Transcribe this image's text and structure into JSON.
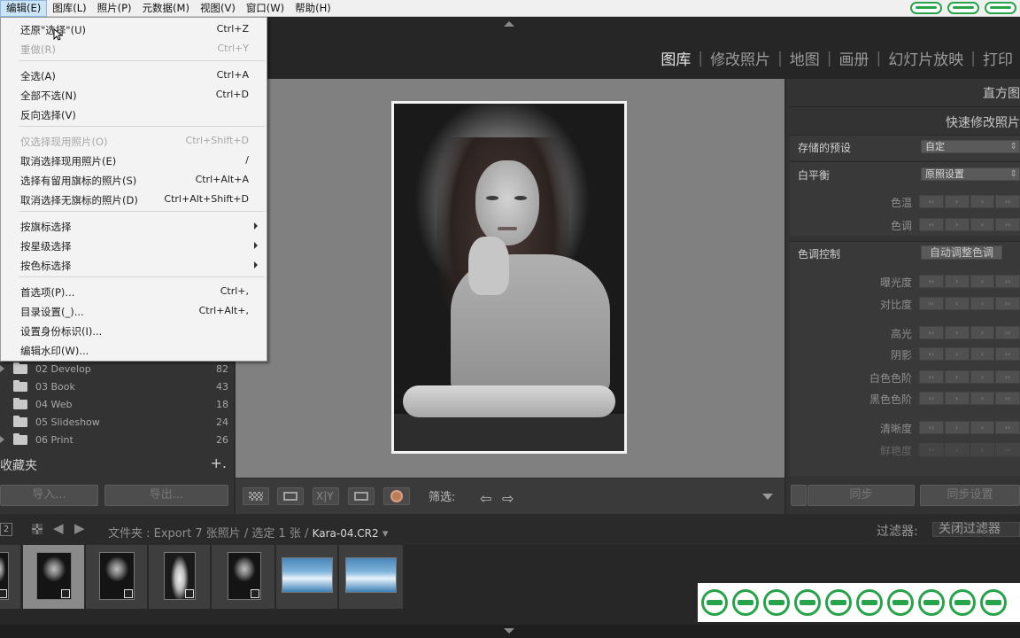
{
  "menubar": {
    "items": [
      {
        "label": "编辑(E)",
        "active": true
      },
      {
        "label": "图库(L)"
      },
      {
        "label": "照片(P)"
      },
      {
        "label": "元数据(M)"
      },
      {
        "label": "视图(V)"
      },
      {
        "label": "窗口(W)"
      },
      {
        "label": "帮助(H)"
      }
    ]
  },
  "modules": [
    "图库",
    "修改照片",
    "地图",
    "画册",
    "幻灯片放映",
    "打印"
  ],
  "edit_menu": {
    "items": [
      {
        "label": "还原\"选择\"(U)",
        "shortcut": "Ctrl+Z"
      },
      {
        "label": "重做(R)",
        "shortcut": "Ctrl+Y",
        "disabled": true
      },
      {
        "label": "全选(A)",
        "shortcut": "Ctrl+A"
      },
      {
        "label": "全部不选(N)",
        "shortcut": "Ctrl+D"
      },
      {
        "label": "反向选择(V)",
        "shortcut": ""
      },
      {
        "label": "仅选择现用照片(O)",
        "shortcut": "Ctrl+Shift+D",
        "disabled": true
      },
      {
        "label": "取消选择现用照片(E)",
        "shortcut": "/"
      },
      {
        "label": "选择有留用旗标的照片(S)",
        "shortcut": "Ctrl+Alt+A"
      },
      {
        "label": "取消选择无旗标的照片(D)",
        "shortcut": "Ctrl+Alt+Shift+D"
      },
      {
        "label": "按旗标选择",
        "shortcut": "",
        "submenu": true
      },
      {
        "label": "按星级选择",
        "shortcut": "",
        "submenu": true
      },
      {
        "label": "按色标选择",
        "shortcut": "",
        "submenu": true
      },
      {
        "label": "首选项(P)...",
        "shortcut": "Ctrl+,"
      },
      {
        "label": "目录设置(_)...",
        "shortcut": "Ctrl+Alt+,"
      },
      {
        "label": "设置身份标识(I)...",
        "shortcut": ""
      },
      {
        "label": "编辑水印(W)...",
        "shortcut": ""
      }
    ]
  },
  "folders": [
    {
      "name": "02 Develop",
      "count": "82"
    },
    {
      "name": "03 Book",
      "count": "43"
    },
    {
      "name": "04 Web",
      "count": "18"
    },
    {
      "name": "05 Slideshow",
      "count": "24"
    },
    {
      "name": "06 Print",
      "count": "26"
    }
  ],
  "collections": {
    "label": "收藏夹",
    "add": "+."
  },
  "left_buttons": {
    "import": "导入...",
    "export": "导出..."
  },
  "toolbar": {
    "filter_label": "筛选:"
  },
  "right_panel": {
    "histogram": "直方图",
    "quick_develop": "快速修改照片",
    "saved_preset_label": "存储的预设",
    "saved_preset_value": "自定",
    "wb_label": "白平衡",
    "wb_value": "原照设置",
    "temp_label": "色温",
    "tint_label": "色调",
    "tone_label": "色调控制",
    "auto_tone": "自动调整色调",
    "exposure": "曝光度",
    "contrast": "对比度",
    "highlights": "高光",
    "shadows": "阴影",
    "whites": "白色色阶",
    "blacks": "黑色色阶",
    "clarity": "清晰度",
    "vibrance": "鲜艳度",
    "sync": "同步",
    "sync_settings": "同步设置"
  },
  "stepper_glyphs": [
    "‹‹",
    "‹",
    "›",
    "››"
  ],
  "filmstrip_bar": {
    "one": "2",
    "folder_prefix": "文件夹 : Export",
    "count_info": "7 张照片 / 选定 1 张 /",
    "filename": "Kara-04.CR2",
    "caret": "▾",
    "filter_label": "过滤器:",
    "filter_value": "关闭过滤器"
  },
  "colors": {
    "accent_green": "#27a44a",
    "menu_bg": "#f3f3f3",
    "panel_bg": "#333333"
  }
}
